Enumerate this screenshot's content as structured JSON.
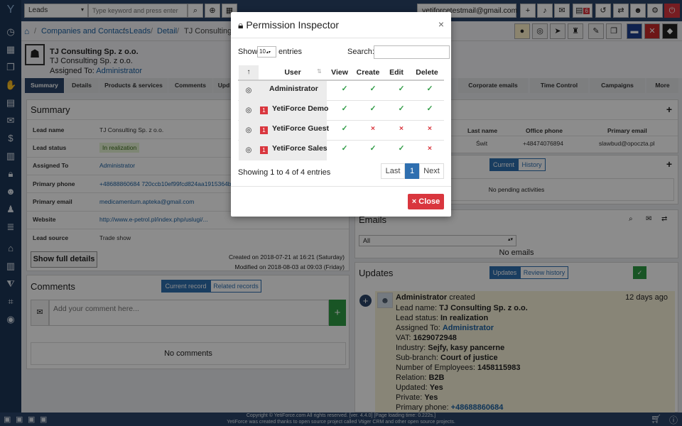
{
  "topbar": {
    "module_select": "Leads",
    "search_placeholder": "Type keyword and press enter",
    "user_email": "yetiforcetestmail@gmail.com",
    "notification_count": "6"
  },
  "breadcrumb": [
    "Companies and Contacts",
    "Leads",
    "Detail",
    "TJ Consulting S"
  ],
  "record": {
    "name": "TJ Consulting Sp. z o.o.",
    "subname": "TJ Consulting Sp. z o.o.",
    "assigned_label": "Assigned To:",
    "assigned_value": "Administrator"
  },
  "tabs": [
    "Summary",
    "Details",
    "Products & services",
    "Comments",
    "Upd",
    "Corporate emails",
    "Time Control",
    "Campaigns",
    "More"
  ],
  "summary": {
    "title": "Summary",
    "fields": [
      {
        "label": "Lead name",
        "value": "TJ Consulting Sp. z o.o."
      },
      {
        "label": "Lead status",
        "value": "In realization"
      },
      {
        "label": "Assigned To",
        "value": "Administrator"
      },
      {
        "label": "Primary phone",
        "value": "+48688860684 720ccb10ef99fcd824aa1915364b"
      },
      {
        "label": "Primary email",
        "value": "medicamentum.apteka@gmail.com"
      },
      {
        "label": "Website",
        "value": "http://www.e-petrol.pl/index.php/uslugi/..."
      },
      {
        "label": "Lead source",
        "value": "Trade show"
      }
    ],
    "show_full": "Show full details",
    "created": "Created on 2018-07-21 at 16:21 (Saturday)",
    "modified": "Modified on 2018-08-03 at 09:03 (Friday)"
  },
  "comments": {
    "title": "Comments",
    "current": "Current record",
    "related": "Related records",
    "placeholder": "Add your comment here...",
    "empty": "No comments"
  },
  "contacts": {
    "headers": [
      "Last name",
      "Office phone",
      "Primary email"
    ],
    "row": [
      "Świt",
      "+48474076894",
      "slawbud@opoczta.pl"
    ]
  },
  "activities": {
    "current": "Current",
    "history": "History",
    "empty": "No pending activities"
  },
  "emails": {
    "title": "Emails",
    "select": "All",
    "empty": "No emails"
  },
  "updates": {
    "title": "Updates",
    "tab_updates": "Updates",
    "tab_review": "Review history",
    "user": "Administrator",
    "action": "created",
    "time": "12 days ago",
    "lines": [
      {
        "label": "Lead name:",
        "value": "TJ Consulting Sp. z o.o."
      },
      {
        "label": "Lead status:",
        "value": "In realization"
      },
      {
        "label": "Assigned To:",
        "value": "Administrator"
      },
      {
        "label": "VAT:",
        "value": "1629072948"
      },
      {
        "label": "Industry:",
        "value": "Sejfy, kasy pancerne"
      },
      {
        "label": "Sub-branch:",
        "value": "Court of justice"
      },
      {
        "label": "Number of Employees:",
        "value": "1458115983"
      },
      {
        "label": "Relation:",
        "value": "B2B"
      },
      {
        "label": "Updated:",
        "value": "Yes"
      },
      {
        "label": "Private:",
        "value": "Yes"
      },
      {
        "label": "Primary phone:",
        "value": "+48688860684"
      }
    ]
  },
  "modal": {
    "title": "Permission Inspector",
    "show_label": "Show",
    "entries_value": "10",
    "entries_label": "entries",
    "search_label": "Search:",
    "headers": [
      "User",
      "View",
      "Create",
      "Edit",
      "Delete"
    ],
    "rows": [
      {
        "user": "Administrator",
        "badge": "",
        "view": true,
        "create": true,
        "edit": true,
        "delete": true
      },
      {
        "user": "YetiForce Demo",
        "badge": "1",
        "view": true,
        "create": true,
        "edit": true,
        "delete": true
      },
      {
        "user": "YetiForce Guest",
        "badge": "1",
        "view": true,
        "create": false,
        "edit": false,
        "delete": false
      },
      {
        "user": "YetiForce Sales",
        "badge": "1",
        "view": true,
        "create": true,
        "edit": true,
        "delete": false
      }
    ],
    "info": "Showing 1 to 4 of 4 entries",
    "pager": [
      "Last",
      "1",
      "Next"
    ],
    "close": "Close"
  },
  "footer": {
    "line1": "Copyright © YetiForce.com All rights reserved. [ver. 4.4.0] [Page loading time: 0.222s.]",
    "line2": "YetiForce was created thanks to open source project called Vtiger CRM and other open source projects."
  }
}
